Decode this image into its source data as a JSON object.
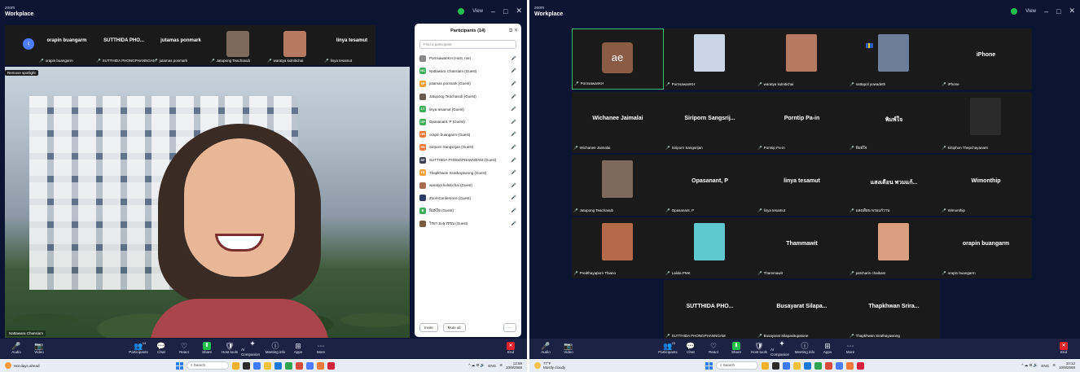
{
  "left": {
    "brand_small": "zoom",
    "brand_large": "Workplace",
    "view_label": "View",
    "win_controls": [
      "–",
      "□",
      "✕"
    ],
    "thumbstrip": [
      {
        "name": "orapin buangarm",
        "sub": "orapin buangarm",
        "video": false
      },
      {
        "name": "SUTTHIDA PHO...",
        "sub": "SUTTHIDA PHONGPHANNGAM",
        "video": false
      },
      {
        "name": "jutamas ponmark",
        "sub": "jutamas ponmark",
        "video": false
      },
      {
        "name": "",
        "sub": "Jatupong Teachasub",
        "video": true,
        "color": "#7d6a5c"
      },
      {
        "name": "",
        "sub": "waratya kulnitichai",
        "video": true,
        "color": "#b47a62"
      },
      {
        "name": "linya tesamut",
        "sub": "linya tesamut",
        "video": false
      }
    ],
    "spotlight_tag": "Remove spotlight",
    "main_video_name": "Nattawara Chansiam",
    "participants": {
      "title": "Participants (14)",
      "search_placeholder": "Find a participant",
      "list": [
        {
          "initials": "",
          "name": "PornsawanKH (Host, me)",
          "color": "#8a8a8a",
          "status": "🎤"
        },
        {
          "initials": "NC",
          "name": "Nattawara Chansiam (Guest)",
          "color": "#3fae5a",
          "status": "🎤"
        },
        {
          "initials": "JP",
          "name": "jutamas ponmark (Guest)",
          "color": "#f2a23a",
          "status": "🎤"
        },
        {
          "initials": "",
          "name": "Jatupong Teachasub (Guest)",
          "color": "#6b5a4e",
          "status": "🎤"
        },
        {
          "initials": "LT",
          "name": "linya tesamut (Guest)",
          "color": "#3fae5a",
          "status": "🎤"
        },
        {
          "initials": "OP",
          "name": "Opasanant, P (Guest)",
          "color": "#3fae5a",
          "status": "🎤"
        },
        {
          "initials": "OB",
          "name": "orapin buangarm (Guest)",
          "color": "#f07a3a",
          "status": "🎤"
        },
        {
          "initials": "SS",
          "name": "Siriporn Sangsrijan (Guest)",
          "color": "#f07a3a",
          "status": "🎤"
        },
        {
          "initials": "SP",
          "name": "SUTTHIDA PHONGPHANNGAM (Guest)",
          "color": "#3a4150",
          "status": "🎤"
        },
        {
          "initials": "TS",
          "name": "Thapkhwan Sirathayawong (Guest)",
          "color": "#f2a23a",
          "status": "🎤"
        },
        {
          "initials": "",
          "name": "waratya kulnitichai (Guest)",
          "color": "#a56e55",
          "status": "🎤"
        },
        {
          "initials": "",
          "name": "ZoomConference (Guest)",
          "color": "#2c3b66",
          "status": "🎤"
        },
        {
          "initials": "พ",
          "name": "พิมพ์ใจ (Guest)",
          "color": "#3fae5a",
          "status": "🎤"
        },
        {
          "initials": "",
          "name": "วิรยา มะธุวรรณ (Guest)",
          "color": "#7b5c43",
          "status": "🎤"
        }
      ],
      "invite": "Invite",
      "mute_all": "Mute all",
      "more": "···"
    },
    "toolbar": [
      {
        "id": "audio",
        "label": "Audio",
        "icon": "🎤"
      },
      {
        "id": "video",
        "label": "Video",
        "icon": "📷"
      },
      {
        "id": "participants",
        "label": "Participants",
        "icon": "👥",
        "count": "14"
      },
      {
        "id": "chat",
        "label": "Chat",
        "icon": "💬"
      },
      {
        "id": "react",
        "label": "React",
        "icon": "♡"
      },
      {
        "id": "share",
        "label": "Share",
        "icon": "⬆"
      },
      {
        "id": "host-tools",
        "label": "Host tools",
        "icon": "🛡"
      },
      {
        "id": "ai-companion",
        "label": "AI Companion",
        "icon": "✦"
      },
      {
        "id": "meeting-info",
        "label": "Meeting info",
        "icon": "ⓘ"
      },
      {
        "id": "apps",
        "label": "Apps",
        "icon": "⊞"
      },
      {
        "id": "more",
        "label": "More",
        "icon": "⋯"
      }
    ],
    "end_label": "End",
    "taskbar": {
      "weather_line1": "Hot days ahead",
      "weather_line2": "",
      "search": "Search",
      "lang": "ENG",
      "time": "12:59",
      "date": "10/9/2568"
    }
  },
  "right": {
    "brand_small": "zoom",
    "brand_large": "Workplace",
    "view_label": "View",
    "win_controls": [
      "–",
      "□",
      "✕"
    ],
    "tiles": [
      {
        "big": "",
        "label": "PornsawanKH",
        "ae": "ae",
        "active": true
      },
      {
        "big": "",
        "label": "PornsawanKH",
        "photo": "#c9d6e6"
      },
      {
        "big": "",
        "label": "waratya kulnitichai",
        "photo": "#b47a62"
      },
      {
        "big": "",
        "label": "nattapol yuwadeth",
        "photo": "#6d7e9a",
        "flag": true
      },
      {
        "big": "iPhone",
        "label": "iPhone"
      },
      {
        "big": "Wichanee Jaimalai",
        "label": "Wichanee Jaimalai"
      },
      {
        "big": "Siriporn Sangsrij...",
        "label": "Siriporn Sangsrijan"
      },
      {
        "big": "Porntip Pa-in",
        "label": "Porntip Pa-in"
      },
      {
        "big": "พิมพ์ใจ",
        "label": "พิมพ์ใจ"
      },
      {
        "big": "",
        "label": "kritiphon Thepchayanant",
        "photo": "#2b2b2b"
      },
      {
        "big": "",
        "label": "Jatupong Teachasub",
        "photo": "#7d6a5c"
      },
      {
        "big": "Opasanant, P",
        "label": "Opasanant, P"
      },
      {
        "big": "linya tesamut",
        "label": "linya tesamut"
      },
      {
        "big": "แสงเดือน พวมแก้...",
        "label": "แสงเดือน พวมแก้วาน"
      },
      {
        "big": "Wimonthip",
        "label": "Wimonthip"
      },
      {
        "big": "",
        "label": "Predthayaporn Thiano",
        "photo": "#b56a4a"
      },
      {
        "big": "",
        "label": "Lalida PMK",
        "photo": "#5fc9d0"
      },
      {
        "big": "Thammawit",
        "label": "Thammawit"
      },
      {
        "big": "",
        "label": "patcharin chaibam",
        "photo": "#d9a07f"
      },
      {
        "big": "orapin buangarm",
        "label": "orapin buangarm"
      },
      {
        "big": "SUTTHIDA PHO...",
        "label": "SUTTHIDA PHONGPHANNGAM"
      },
      {
        "big": "Busayarat Silapa...",
        "label": "Busayarat Silapasitupatone"
      },
      {
        "big": "Thapkhwan Srira...",
        "label": "Thapkhwan Sirathayawong"
      }
    ],
    "toolbar": [
      {
        "id": "audio",
        "label": "Audio",
        "icon": "🎤"
      },
      {
        "id": "video",
        "label": "Video",
        "icon": "📷"
      },
      {
        "id": "participants",
        "label": "Participants",
        "icon": "👥",
        "count": "23"
      },
      {
        "id": "chat",
        "label": "Chat",
        "icon": "💬"
      },
      {
        "id": "react",
        "label": "React",
        "icon": "♡"
      },
      {
        "id": "share",
        "label": "Share",
        "icon": "⬆"
      },
      {
        "id": "host-tools",
        "label": "Host tools",
        "icon": "🛡"
      },
      {
        "id": "ai-companion",
        "label": "AI Companion",
        "icon": "✦"
      },
      {
        "id": "meeting-info",
        "label": "Meeting info",
        "icon": "ⓘ"
      },
      {
        "id": "apps",
        "label": "Apps",
        "icon": "⊞"
      },
      {
        "id": "more",
        "label": "More",
        "icon": "⋯"
      }
    ],
    "end_label": "End",
    "taskbar": {
      "weather_line1": "77°F",
      "weather_line2": "Mostly cloudy",
      "search": "Search",
      "lang": "ENG",
      "time": "10:12",
      "date": "10/9/2568"
    }
  }
}
